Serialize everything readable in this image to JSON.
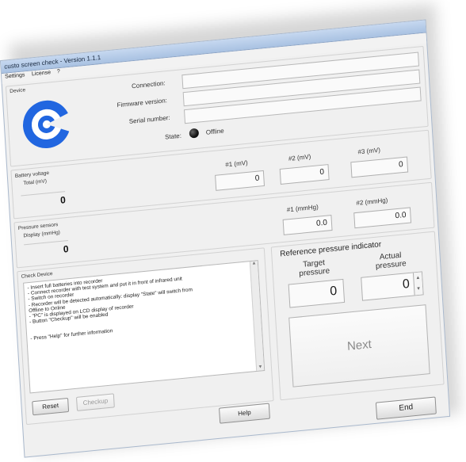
{
  "window": {
    "title": "custo screen check - Version 1.1.1"
  },
  "menu": {
    "items": [
      "Settings",
      "License",
      "?"
    ]
  },
  "device": {
    "section_label": "Device",
    "connection_label": "Connection:",
    "firmware_label": "Firmware version:",
    "serial_label": "Serial number:",
    "state_label": "State:",
    "state_value": "Offline",
    "connection_value": "",
    "firmware_value": "",
    "serial_value": "",
    "logo_color": "#2166e0"
  },
  "battery": {
    "title": "Battery voltage",
    "total_label": "Total (mV)",
    "total_value": "0",
    "ch1_label": "#1 (mV)",
    "ch1_value": "0",
    "ch2_label": "#2 (mV)",
    "ch2_value": "0",
    "ch3_label": "#3 (mV)",
    "ch3_value": "0"
  },
  "pressure": {
    "title": "Pressure sensors",
    "display_label": "Display (mmHg)",
    "display_value": "0",
    "ch1_label": "#1 (mmHg)",
    "ch1_value": "0.0",
    "ch2_label": "#2 (mmHg)",
    "ch2_value": "0.0"
  },
  "check": {
    "title": "Check Device",
    "instructions": [
      "- Insert full batteries into recorder",
      "- Connect recorder with test system and put it in front of infrared unit",
      "- Switch on recorder",
      "- Recorder will be detected automatically: display \"State\" will switch from",
      "Offline to Online",
      "- \"PC\" is displayed on LCD display of recorder",
      "- Button \"Checkup\" will be enabled",
      "",
      "",
      "- Press \"Help\" for further information"
    ],
    "reset_label": "Reset",
    "checkup_label": "Checkup"
  },
  "reference": {
    "title": "Reference pressure indicator",
    "target_label_1": "Target",
    "target_label_2": "pressure",
    "target_value": "0",
    "actual_label_1": "Actual",
    "actual_label_2": "pressure",
    "actual_value": "0",
    "next_label": "Next"
  },
  "footer": {
    "help_label": "Help",
    "end_label": "End"
  }
}
